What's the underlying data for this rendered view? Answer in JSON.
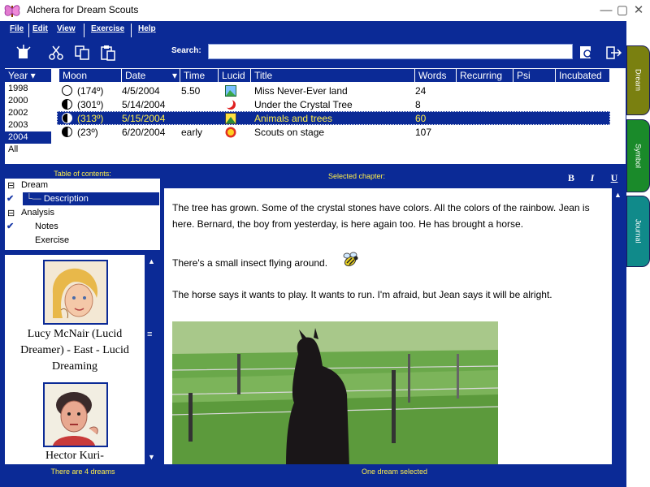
{
  "window": {
    "title": "Alchera for Dream Scouts"
  },
  "menu": {
    "file": "File",
    "edit": "Edit",
    "view": "View",
    "exercise": "Exercise",
    "help": "Help"
  },
  "toolbar": {
    "icons": [
      "new-icon",
      "cut-icon",
      "copy-icon",
      "paste-icon",
      "search-go-icon",
      "exit-icon"
    ],
    "search_label": "Search:",
    "search_value": ""
  },
  "side_tabs": {
    "dream": "Dream",
    "symbol": "Symbol",
    "journal": "Journal",
    "dream_color": "#7a8010",
    "symbol_color": "#1a8a2a",
    "journal_color": "#108a8a"
  },
  "years": {
    "header": "Year",
    "items": [
      "1998",
      "2000",
      "2002",
      "2003",
      "2004",
      "All"
    ],
    "selected": "2004"
  },
  "dreams": {
    "columns": [
      "Moon",
      "Date",
      "Time",
      "Lucid",
      "Title",
      "Words",
      "Recurring",
      "Psi",
      "Incubated"
    ],
    "rows": [
      {
        "moon": "(174º)",
        "date": "4/5/2004",
        "time": "5.50",
        "lucid_icon": "picture-icon",
        "title": "Miss Never-Ever land",
        "words": "24"
      },
      {
        "moon": "(301º)",
        "date": "5/14/2004",
        "time": "",
        "lucid_icon": "crescent-moon-icon",
        "title": "Under the Crystal Tree",
        "words": "8"
      },
      {
        "moon": "(313º)",
        "date": "5/15/2004",
        "time": "",
        "lucid_icon": "landscape-icon",
        "title": "Animals and trees",
        "words": "60"
      },
      {
        "moon": "(23º)",
        "date": "6/20/2004",
        "time": "early",
        "lucid_icon": "sun-icon",
        "title": "Scouts on stage",
        "words": "107"
      }
    ],
    "selected_index": 2
  },
  "toc": {
    "header": "Table of contents:",
    "items": [
      {
        "label": "Dream"
      },
      {
        "label": "Description"
      },
      {
        "label": "Analysis"
      },
      {
        "label": "Notes"
      },
      {
        "label": "Exercise"
      }
    ]
  },
  "people": [
    {
      "name": "Lucy McNair (Lucid Dreamer) - East - Lucid Dreaming"
    },
    {
      "name": "Hector Kuri-"
    }
  ],
  "chapter": {
    "header": "Selected chapter:",
    "format_bold": "B",
    "format_italic": "I",
    "format_underline": "U",
    "paragraphs": [
      "The tree has grown. Some of the crystal stones have colors. All the colors of the rainbow. Jean is here. Bernard, the boy from yesterday, is here again too. He has brought a horse.",
      "There's a small insect flying around.",
      "The horse says it wants to play. It wants to run. I'm afraid, but Jean says it will be alright."
    ]
  },
  "status": {
    "left": "There are 4 dreams",
    "right": "One dream selected"
  },
  "colors": {
    "frame": "#0b2a96",
    "highlight_text": "#ffef4a",
    "selected_row_text": "#ffef4a"
  }
}
